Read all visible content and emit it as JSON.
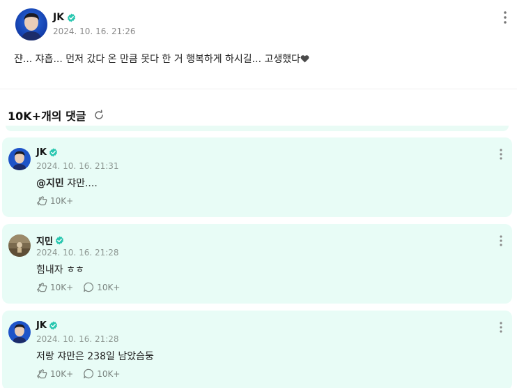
{
  "post": {
    "author": "JK",
    "date": "2024. 10. 16. 21:26",
    "text": "쟌... 쟈흡... 먼저 갔다 온 만큼 못다 한 거 행복하게 하시길... 고생했다",
    "avatar_icon": "profile-photo"
  },
  "comments_header": {
    "title": "10K+개의 댓글",
    "refresh_icon": "refresh-icon"
  },
  "colors": {
    "card_bg": "#e8fcf6",
    "verified": "#29c7b0",
    "muted": "#8d9792"
  },
  "comments": [
    {
      "author": "JK",
      "date": "2024. 10. 16. 21:31",
      "mention": "@지민",
      "text": " 쟈만....",
      "likes": "10K+"
    },
    {
      "author": "지민",
      "date": "2024. 10. 16. 21:28",
      "text": "힘내자 ㅎㅎ",
      "likes": "10K+",
      "replies": "10K+"
    },
    {
      "author": "JK",
      "date": "2024. 10. 16. 21:28",
      "text": "저랑 쟈만은 238일 남았슴둥",
      "likes": "10K+",
      "replies": "10K+"
    }
  ]
}
